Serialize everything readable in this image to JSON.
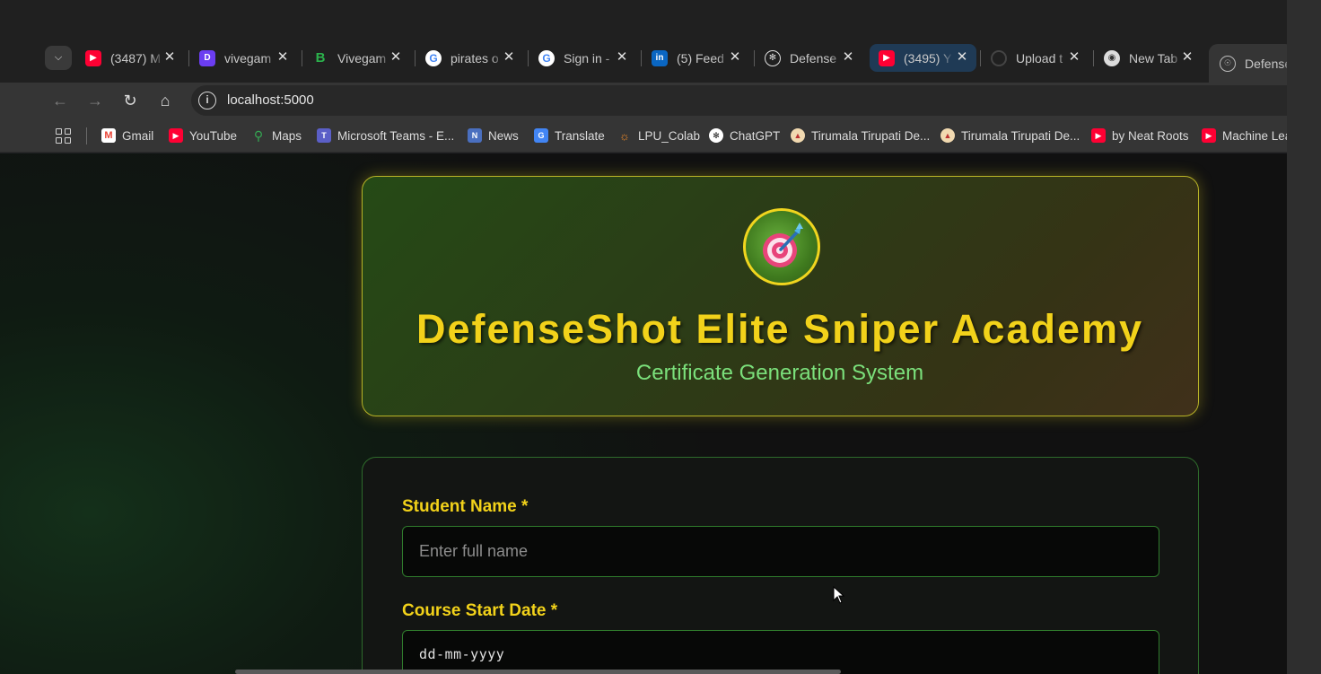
{
  "browser": {
    "tabs": [
      {
        "title": "(3487) M",
        "icon": "youtube-icon",
        "color": "#ff0033"
      },
      {
        "title": "vivegam",
        "icon": "app-icon",
        "color": "#6b3df2"
      },
      {
        "title": "Vivegam",
        "icon": "app-icon",
        "color": "#2b7a3a"
      },
      {
        "title": "pirates o",
        "icon": "google-icon",
        "color": "#ffffff"
      },
      {
        "title": "Sign in -",
        "icon": "google-icon",
        "color": "#ffffff"
      },
      {
        "title": "(5) Feed",
        "icon": "linkedin-icon",
        "color": "#0a66c2"
      },
      {
        "title": "Defense",
        "icon": "chatgpt-icon",
        "color": "#ffffff"
      },
      {
        "title": "(3495) Y",
        "icon": "youtube-icon",
        "color": "#ff0033"
      },
      {
        "title": "Upload t",
        "icon": "loading-icon",
        "color": "#555555"
      },
      {
        "title": "New Tab",
        "icon": "chrome-icon",
        "color": "#dddddd"
      },
      {
        "title": "Defense",
        "icon": "globe-icon",
        "color": "#dddddd"
      }
    ],
    "url": "localhost:5000",
    "bookmarks": [
      {
        "label": "Gmail",
        "icon": "gmail-icon"
      },
      {
        "label": "YouTube",
        "icon": "youtube-icon"
      },
      {
        "label": "Maps",
        "icon": "maps-icon"
      },
      {
        "label": "Microsoft Teams - E...",
        "icon": "teams-icon"
      },
      {
        "label": "News",
        "icon": "news-icon"
      },
      {
        "label": "Translate",
        "icon": "translate-icon"
      },
      {
        "label": "LPU_Colab",
        "icon": "colab-icon"
      },
      {
        "label": "ChatGPT",
        "icon": "chatgpt-icon"
      },
      {
        "label": "Tirumala Tirupati De...",
        "icon": "temple-icon"
      },
      {
        "label": "Tirumala Tirupati De...",
        "icon": "temple-icon"
      },
      {
        "label": "by Neat Roots",
        "icon": "youtube-icon"
      },
      {
        "label": "Machine Lea",
        "icon": "youtube-icon"
      }
    ]
  },
  "page": {
    "logo_icon": "target-dart-icon",
    "title": "DefenseShot Elite Sniper Academy",
    "subtitle": "Certificate Generation System",
    "form": {
      "student_name_label": "Student Name *",
      "student_name_placeholder": "Enter full name",
      "start_date_label": "Course Start Date *",
      "start_date_value": "dd-mm-yyyy"
    }
  },
  "colors": {
    "accent": "#f2d21a",
    "subtitle": "#7be07b",
    "border_green": "#2f7b2c"
  }
}
